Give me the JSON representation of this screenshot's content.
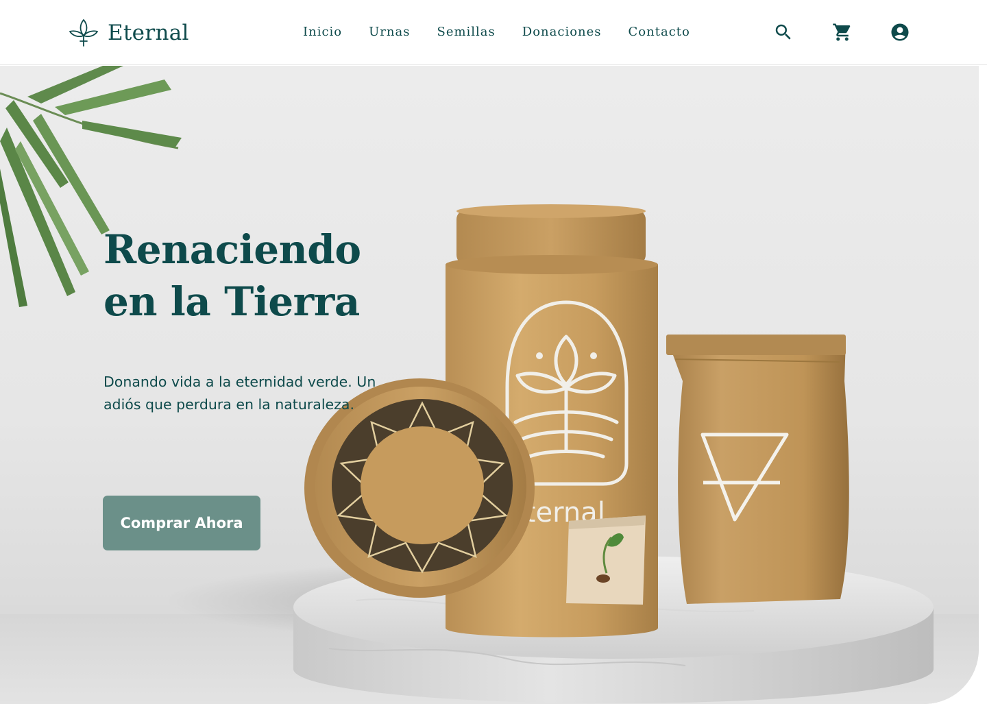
{
  "brand": {
    "name": "Eternal",
    "logo_icon": "lotus-leaf-icon",
    "color": "#0e4a4b"
  },
  "nav": {
    "items": [
      {
        "label": "Inicio"
      },
      {
        "label": "Urnas"
      },
      {
        "label": "Semillas"
      },
      {
        "label": "Donaciones"
      },
      {
        "label": "Contacto"
      }
    ]
  },
  "header_actions": [
    {
      "icon": "search-icon"
    },
    {
      "icon": "cart-icon"
    },
    {
      "icon": "account-icon"
    }
  ],
  "hero": {
    "title_line1": "Renaciendo",
    "title_line2": "en la Tierra",
    "subtitle": "Donando vida a la eternidad verde. Un adiós que perdura en la naturaleza.",
    "cta_label": "Comprar Ahora",
    "urn_logo_text": "eternal",
    "illustration": "biodegradable-urn-product-scene",
    "cta_color": "#6b9089",
    "text_color": "#0e4a4b"
  }
}
